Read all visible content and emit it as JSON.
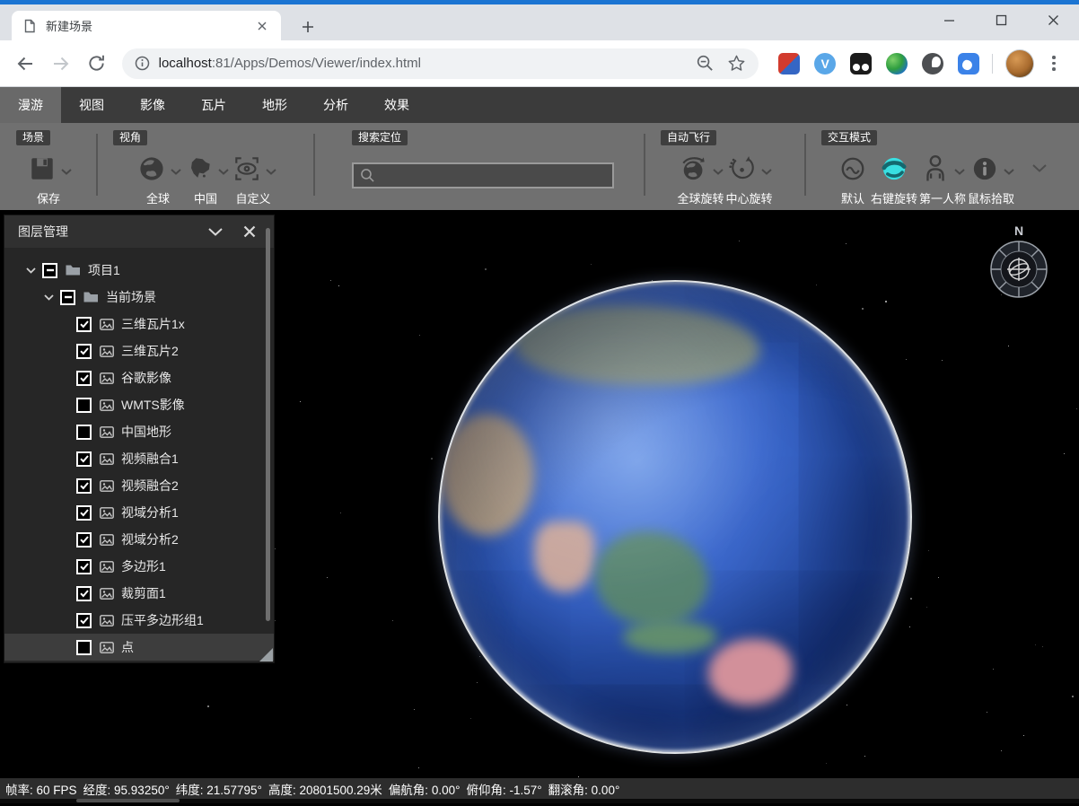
{
  "browser": {
    "tab": {
      "title": "新建场景",
      "icons": [
        "page-icon",
        "close-icon"
      ]
    },
    "new_tab_icon": "plus-icon",
    "window_controls": [
      "minimize-icon",
      "maximize-icon",
      "close-icon"
    ],
    "nav_icons": [
      "back-icon",
      "forward-icon",
      "reload-icon"
    ],
    "url": {
      "host": "localhost",
      "path": ":81/Apps/Demos/Viewer/index.html",
      "secure_icon": "info-icon"
    },
    "urlbar_right_icons": [
      "zoom-out-icon",
      "star-icon"
    ],
    "extensions": [
      {
        "icon": "red-blue-cube-extension-icon"
      },
      {
        "icon": "v-letter-extension-icon",
        "letter": "V"
      },
      {
        "icon": "two-dots-extension-icon"
      },
      {
        "icon": "green-globe-extension-icon"
      },
      {
        "icon": "dark-circle-extension-icon"
      },
      {
        "icon": "blue-badge-extension-icon"
      }
    ],
    "profile_icon": "avatar",
    "menu_icon": "kebab-menu-icon"
  },
  "ribbon": {
    "tabs": [
      {
        "label": "漫游",
        "active": true
      },
      {
        "label": "视图",
        "active": false
      },
      {
        "label": "影像",
        "active": false
      },
      {
        "label": "瓦片",
        "active": false
      },
      {
        "label": "地形",
        "active": false
      },
      {
        "label": "分析",
        "active": false
      },
      {
        "label": "效果",
        "active": false
      }
    ],
    "groups": {
      "scene": {
        "label": "场景",
        "buttons": [
          {
            "label": "保存",
            "icon": "save-icon",
            "dropdown": true
          }
        ]
      },
      "view": {
        "label": "视角",
        "buttons": [
          {
            "label": "全球",
            "icon": "globe-icon",
            "dropdown": true
          },
          {
            "label": "中国",
            "icon": "china-map-icon",
            "dropdown": true
          },
          {
            "label": "自定义",
            "icon": "custom-view-eye-icon",
            "dropdown": true
          }
        ]
      },
      "search": {
        "label": "搜索定位",
        "value": "",
        "icon": "search-icon"
      },
      "autofly": {
        "label": "自动飞行",
        "buttons": [
          {
            "label": "全球旋转",
            "icon": "globe-rotate-icon",
            "dropdown": true
          },
          {
            "label": "中心旋转",
            "icon": "center-rotate-icon",
            "dropdown": true
          }
        ]
      },
      "interact": {
        "label": "交互模式",
        "buttons": [
          {
            "label": "默认",
            "icon": "default-mode-icon",
            "dropdown": false
          },
          {
            "label": "右键旋转",
            "icon": "right-drag-rotate-icon",
            "dropdown": false,
            "active": true,
            "active_color": "#38dfe1"
          },
          {
            "label": "第一人称",
            "icon": "first-person-icon",
            "dropdown": true
          },
          {
            "label": "鼠标拾取",
            "icon": "mouse-pick-info-icon",
            "dropdown": true
          }
        ]
      }
    },
    "collapse_icon": "chevron-down-icon"
  },
  "layer_panel": {
    "title": "图层管理",
    "header_icons": [
      "chevron-down-icon",
      "close-icon"
    ],
    "items": [
      {
        "label": "项目1",
        "level": 0,
        "type": "folder",
        "checkbox": "indeterminate",
        "expanded": true
      },
      {
        "label": "当前场景",
        "level": 1,
        "type": "folder",
        "checkbox": "indeterminate",
        "expanded": true
      },
      {
        "label": "三维瓦片1x",
        "level": 2,
        "type": "layer",
        "checkbox": "checked"
      },
      {
        "label": "三维瓦片2",
        "level": 2,
        "type": "layer",
        "checkbox": "checked"
      },
      {
        "label": "谷歌影像",
        "level": 2,
        "type": "layer",
        "checkbox": "checked"
      },
      {
        "label": "WMTS影像",
        "level": 2,
        "type": "layer",
        "checkbox": "unchecked"
      },
      {
        "label": "中国地形",
        "level": 2,
        "type": "layer",
        "checkbox": "unchecked"
      },
      {
        "label": "视频融合1",
        "level": 2,
        "type": "layer",
        "checkbox": "checked"
      },
      {
        "label": "视频融合2",
        "level": 2,
        "type": "layer",
        "checkbox": "checked"
      },
      {
        "label": "视域分析1",
        "level": 2,
        "type": "layer",
        "checkbox": "checked"
      },
      {
        "label": "视域分析2",
        "level": 2,
        "type": "layer",
        "checkbox": "checked"
      },
      {
        "label": "多边形1",
        "level": 2,
        "type": "layer",
        "checkbox": "checked"
      },
      {
        "label": "裁剪面1",
        "level": 2,
        "type": "layer",
        "checkbox": "checked"
      },
      {
        "label": "压平多边形组1",
        "level": 2,
        "type": "layer",
        "checkbox": "checked"
      },
      {
        "label": "点",
        "level": 2,
        "type": "layer",
        "checkbox": "unchecked",
        "highlighted": true
      }
    ]
  },
  "viewer": {
    "compass_north_label": "N"
  },
  "status_bar": {
    "fields": [
      {
        "label": "帧率:",
        "value": "60 FPS"
      },
      {
        "label": "经度:",
        "value": "95.93250°"
      },
      {
        "label": "纬度:",
        "value": "21.57795°"
      },
      {
        "label": "高度:",
        "value": "20801500.29米"
      },
      {
        "label": "偏航角:",
        "value": "0.00°"
      },
      {
        "label": "俯仰角:",
        "value": "-1.57°"
      },
      {
        "label": "翻滚角:",
        "value": "0.00°"
      }
    ]
  },
  "colors": {
    "accent_blue": "#1b74d2",
    "active_mode_cyan": "#38dfe1",
    "ribbon_gray": "#707070",
    "panel_dark": "#262626"
  }
}
